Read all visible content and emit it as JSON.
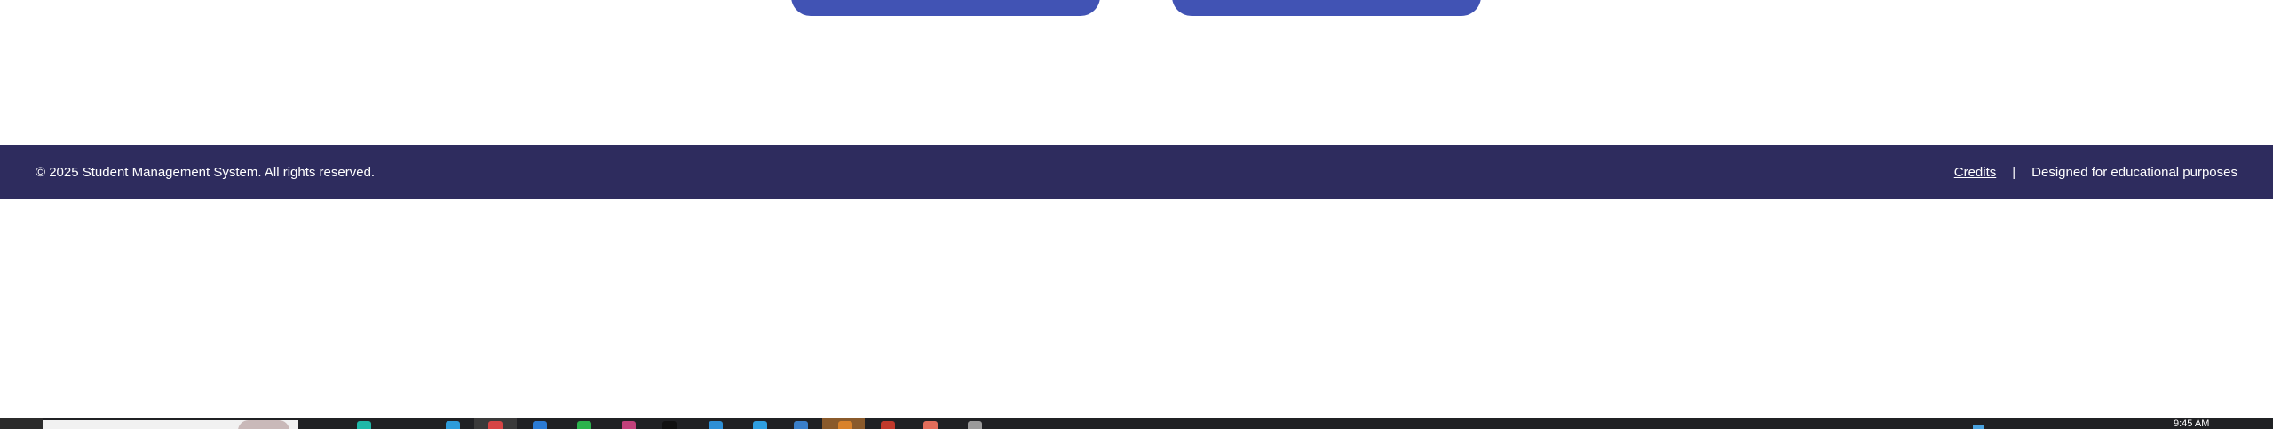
{
  "footer": {
    "copyright": "© 2025 Student Management System. All rights reserved.",
    "credits_link": "Credits",
    "separator": "|",
    "tagline": "Designed for educational purposes"
  },
  "taskbar": {
    "time": "9:45 AM"
  },
  "colors": {
    "button_bg": "#4153b4",
    "footer_bg": "#2e2c5e",
    "footer_text": "#ffffff",
    "taskbar_bg": "#202124"
  },
  "taskbar_apps": [
    {
      "icon": "chrome-icon",
      "color": "#1fb8a8"
    },
    {
      "icon": "file-explorer-icon",
      "color": "#2d9cdb"
    },
    {
      "icon": "opera-icon",
      "color": "#d64545"
    },
    {
      "icon": "edge-icon",
      "color": "#2b7bd4"
    },
    {
      "icon": "spotify-icon",
      "color": "#2bb24c"
    },
    {
      "icon": "app-icon",
      "color": "#c2417b"
    },
    {
      "icon": "terminal-icon",
      "color": "#111111"
    },
    {
      "icon": "vscode-icon",
      "color": "#2d8fd6"
    },
    {
      "icon": "app-icon",
      "color": "#2f9fe0"
    },
    {
      "icon": "app-icon",
      "color": "#3a7fc9"
    },
    {
      "icon": "app-icon",
      "color": "#d9822b"
    },
    {
      "icon": "app-icon",
      "color": "#c0392b"
    },
    {
      "icon": "app-icon",
      "color": "#e26d5a"
    },
    {
      "icon": "app-icon",
      "color": "#9a9a9a"
    }
  ]
}
